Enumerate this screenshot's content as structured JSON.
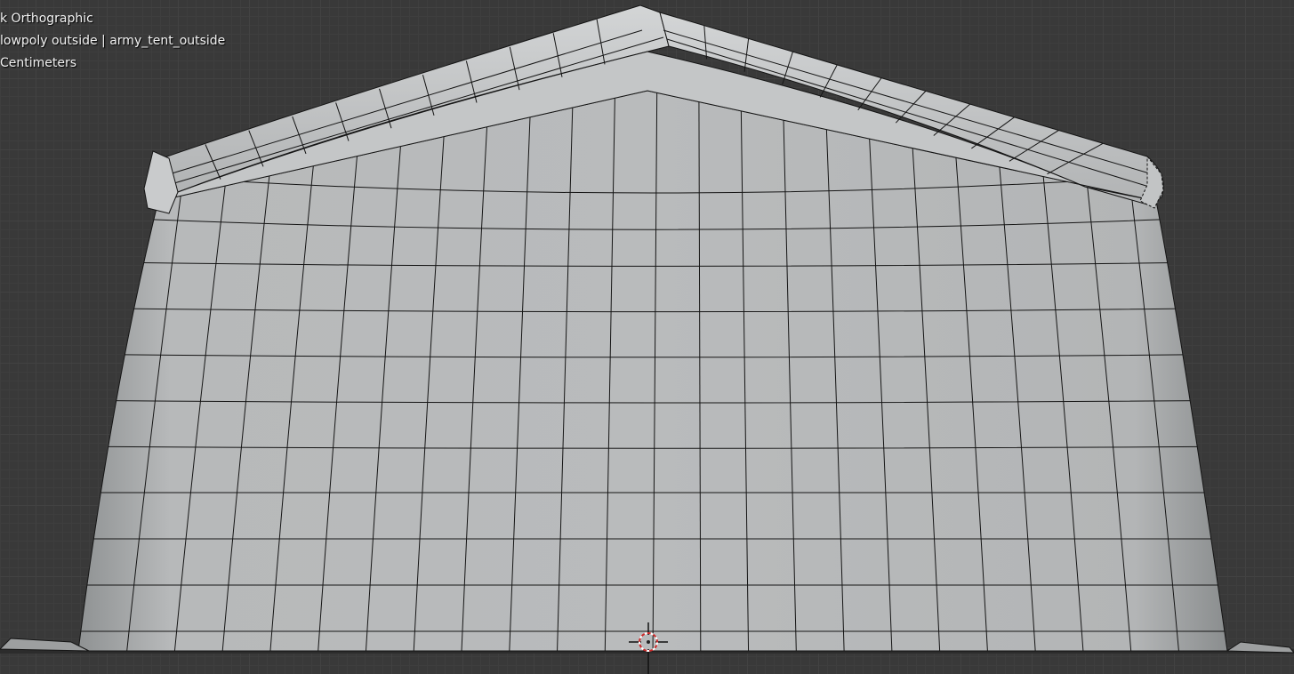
{
  "viewport": {
    "view_label": "k Orthographic",
    "object_label": "lowpoly outside | army_tent_outside",
    "units_label": "Centimeters"
  },
  "colors": {
    "background": "#393939",
    "grid_major": "#424242",
    "mesh_surface": "#b4b6b7",
    "wire": "#111111",
    "cursor": "#cc2a2a"
  },
  "icons": {
    "cursor": "3d-cursor-icon"
  }
}
